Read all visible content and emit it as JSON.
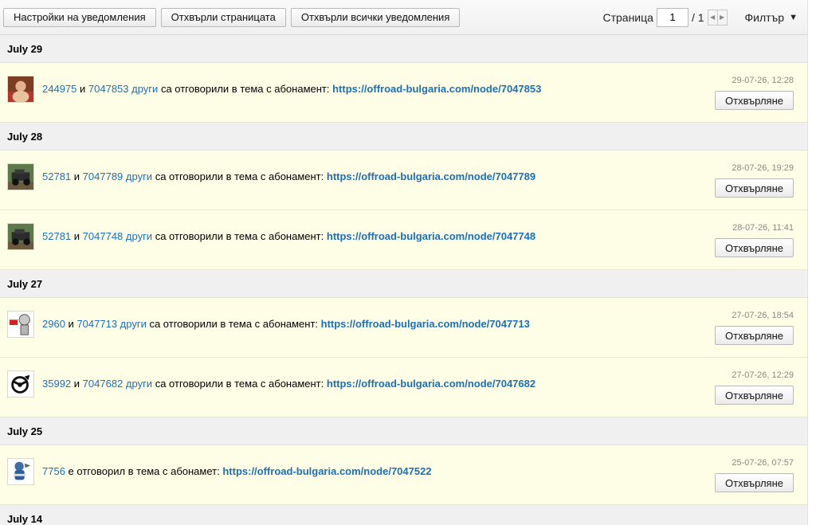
{
  "toolbar": {
    "settings_label": "Настройки на уведомления",
    "reject_page_label": "Отхвърли страницата",
    "reject_all_label": "Отхвърли всички уведомления",
    "page_label": "Страница",
    "page_value": "1",
    "page_total": "/ 1",
    "filter_label": "Филтър"
  },
  "groups": [
    {
      "date": "July 29",
      "items": [
        {
          "user": "244975",
          "conj": "и",
          "others": "7047853 други",
          "text": "са отговорили в тема с абонамент:",
          "url": "https://offroad-bulgaria.com/node/7047853",
          "time": "29-07-26, 12:28",
          "button": "Отхвърляне",
          "avatar": "person-avatar"
        }
      ]
    },
    {
      "date": "July 28",
      "items": [
        {
          "user": "52781",
          "conj": "и",
          "others": "7047789 други",
          "text": "са отговорили в тема с абонамент:",
          "url": "https://offroad-bulgaria.com/node/7047789",
          "time": "28-07-26, 19:29",
          "button": "Отхвърляне",
          "avatar": "jeep-avatar"
        },
        {
          "user": "52781",
          "conj": "и",
          "others": "7047748 други",
          "text": "са отговорили в тема с абонамент:",
          "url": "https://offroad-bulgaria.com/node/7047748",
          "time": "28-07-26, 11:41",
          "button": "Отхвърляне",
          "avatar": "jeep-avatar"
        }
      ]
    },
    {
      "date": "July 27",
      "items": [
        {
          "user": "2960",
          "conj": "и",
          "others": "7047713 други",
          "text": "са отговорили в тема с абонамент:",
          "url": "https://offroad-bulgaria.com/node/7047713",
          "time": "27-07-26, 18:54",
          "button": "Отхвърляне",
          "avatar": "cartoon-avatar"
        },
        {
          "user": "35992",
          "conj": "и",
          "others": "7047682 други",
          "text": "са отговорили в тема с абонамент:",
          "url": "https://offroad-bulgaria.com/node/7047682",
          "time": "27-07-26, 12:29",
          "button": "Отхвърляне",
          "avatar": "wheel-avatar"
        }
      ]
    },
    {
      "date": "July 25",
      "items": [
        {
          "user": "7756",
          "conj": "",
          "others": "",
          "text": "е отговорил в тема с абонамет:",
          "url": "https://offroad-bulgaria.com/node/7047522",
          "time": "25-07-26, 07:57",
          "button": "Отхвърляне",
          "avatar": "mascot-avatar"
        }
      ]
    },
    {
      "date": "July 14",
      "items": []
    }
  ]
}
